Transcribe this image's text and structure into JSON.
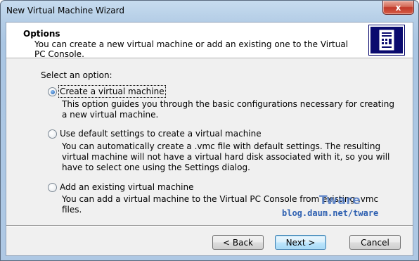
{
  "window": {
    "title": "New Virtual Machine Wizard",
    "close_glyph": "x"
  },
  "header": {
    "title": "Options",
    "description": "You can create a new virtual machine or add an existing one to the Virtual PC Console.",
    "icon": "computer-tower-icon"
  },
  "options": {
    "heading": "Select an option:",
    "items": [
      {
        "label": "Create a virtual machine",
        "description": "This option guides you through the basic configurations necessary for creating a new virtual machine.",
        "selected": true
      },
      {
        "label": "Use default settings to create a virtual machine",
        "description": "You can automatically create a .vmc file with default settings. The resulting virtual machine will not have a virtual hard disk associated with it, so you will have to select one using the Settings dialog.",
        "selected": false
      },
      {
        "label": "Add an existing virtual machine",
        "description": "You can add a virtual machine to the Virtual PC Console from existing .vmc files.",
        "selected": false
      }
    ]
  },
  "watermark": {
    "name": "Tware",
    "url": "blog.daum.net/tware"
  },
  "buttons": {
    "back": "< Back",
    "next": "Next >",
    "cancel": "Cancel"
  },
  "colors": {
    "title_bar": "#b4cde6",
    "header_icon_bg": "#0a0a6e",
    "close_button": "#c1392a",
    "default_button_border": "#3c7fb1"
  }
}
